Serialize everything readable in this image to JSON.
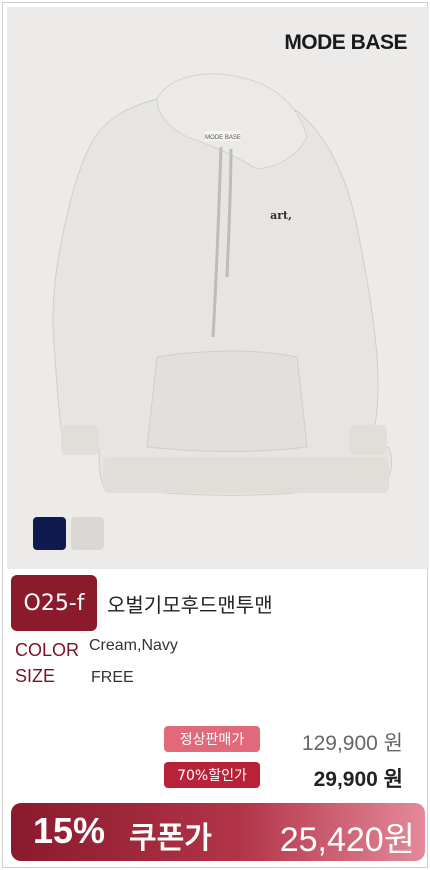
{
  "brand": "MODE BASE",
  "product": {
    "code": "O25-f",
    "name": "오벌기모후드맨투맨",
    "hoodie_print": "art,",
    "neck_label": "MODE BASE"
  },
  "swatches": [
    {
      "name": "navy",
      "color": "#0f1a4e"
    },
    {
      "name": "cream",
      "color": "#d9d8d4"
    }
  ],
  "specs": {
    "color_label": "COLOR",
    "color_value": "Cream,Navy",
    "size_label": "SIZE",
    "size_value": "FREE"
  },
  "pricing": {
    "normal_label": "정상판매가",
    "normal_price": "129,900 원",
    "sale_label": "70%할인가",
    "sale_price": "29,900 원"
  },
  "coupon": {
    "percent": "15%",
    "label": "쿠폰가",
    "price": "25,420원"
  }
}
